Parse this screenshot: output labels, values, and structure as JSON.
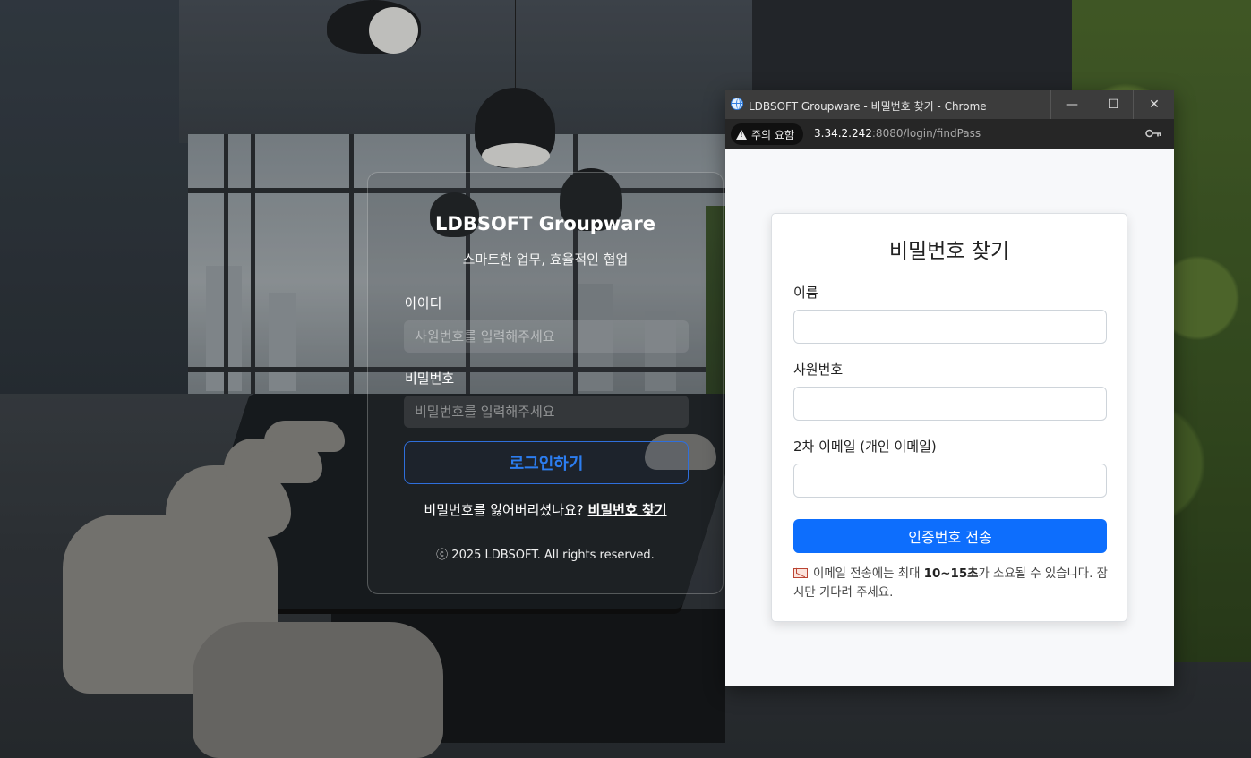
{
  "login": {
    "title": "LDBSOFT Groupware",
    "subtitle": "스마트한 업무, 효율적인 협업",
    "id_label": "아이디",
    "id_placeholder": "사원번호를 입력해주세요",
    "pw_label": "비밀번호",
    "pw_placeholder": "비밀번호를 입력해주세요",
    "login_button": "로그인하기",
    "forgot_text": "비밀번호를 잃어버리셨나요?",
    "forgot_link": "비밀번호 찾기",
    "copyright": "ⓒ 2025 LDBSOFT. All rights reserved."
  },
  "popup": {
    "window_title": "LDBSOFT Groupware - 비밀번호 찾기 - Chrome",
    "security_chip": "주의 요함",
    "url_host": "3.34.2.242",
    "url_path": ":8080/login/findPass",
    "minimize_glyph": "—",
    "maximize_glyph": "☐",
    "close_glyph": "✕",
    "icons": {
      "site": "globe-icon",
      "warning": "warning-icon",
      "password": "key-icon",
      "mail": "mail-icon"
    }
  },
  "find_pass": {
    "title": "비밀번호 찾기",
    "name_label": "이름",
    "name_value": "",
    "emp_label": "사원번호",
    "emp_value": "",
    "email_label": "2차 이메일 (개인 이메일)",
    "email_value": "",
    "send_button": "인증번호 전송",
    "notice_pre": "이메일 전송에는 최대 ",
    "notice_bold": "10~15초",
    "notice_post": "가 소요될 수 있습니다. 잠시만 기다려 주세요."
  },
  "colors": {
    "primary": "#0d6efd",
    "login_accent": "#2c7df0",
    "titlebar": "#3c3c3c"
  }
}
